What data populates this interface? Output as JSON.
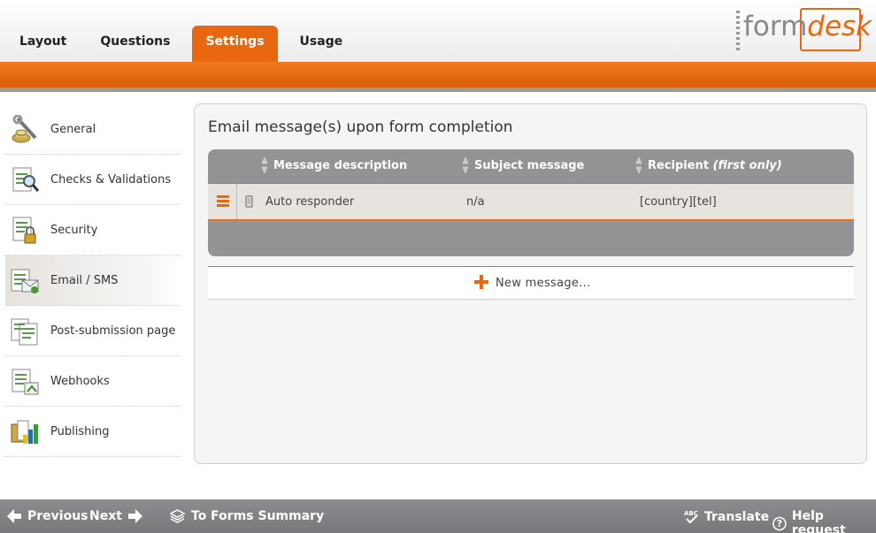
{
  "tabs": [
    {
      "label": "Layout",
      "active": false
    },
    {
      "label": "Questions",
      "active": false
    },
    {
      "label": "Settings",
      "active": true
    },
    {
      "label": "Usage",
      "active": false
    }
  ],
  "logo": {
    "text_left": "form",
    "text_right": "desk"
  },
  "sidebar": {
    "items": [
      {
        "label": "General",
        "icon": "wrench-icon"
      },
      {
        "label": "Checks & Validations",
        "icon": "magnifier-check-icon"
      },
      {
        "label": "Security",
        "icon": "lock-document-icon"
      },
      {
        "label": "Email / SMS",
        "icon": "email-document-icon",
        "active": true
      },
      {
        "label": "Post-submission page",
        "icon": "documents-icon"
      },
      {
        "label": "Webhooks",
        "icon": "webhook-document-icon"
      },
      {
        "label": "Publishing",
        "icon": "publishing-icon"
      }
    ]
  },
  "main": {
    "title": "Email message(s) upon form completion",
    "columns": [
      "Message description",
      "Subject message",
      "Recipient",
      "(first only)"
    ],
    "rows": [
      {
        "description": "Auto responder",
        "subject": "n/a",
        "recipient": "[country][tel]"
      }
    ],
    "new_message_label": "New message..."
  },
  "footer": {
    "previous": "Previous",
    "next": "Next",
    "forms_summary": "To Forms Summary",
    "translate": "Translate",
    "help": "Help request"
  },
  "colors": {
    "accent": "#e8670f",
    "grid": "#939396",
    "footer": "#838386"
  }
}
